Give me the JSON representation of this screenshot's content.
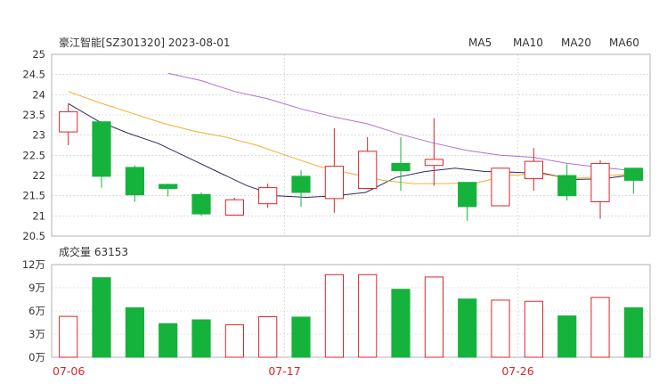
{
  "header": {
    "title": "豪江智能[SZ301320] 2023-08-01",
    "legend": [
      {
        "label": "MA5",
        "color": "#2b2b5e"
      },
      {
        "label": "MA10",
        "color": "#f0b030"
      },
      {
        "label": "MA20",
        "color": "#b070d8"
      },
      {
        "label": "MA60",
        "color": "#e890d8"
      }
    ]
  },
  "volume_panel": {
    "label": "成交量 63153"
  },
  "colors": {
    "up": "#d9262c",
    "down": "#15b33c",
    "grid": "#c8c8c8",
    "frame": "#b0b0b0"
  },
  "chart_data": [
    {
      "type": "candlestick",
      "title": "豪江智能[SZ301320] 2023-08-01",
      "ylim": [
        20.5,
        25
      ],
      "yticks": [
        "25",
        "24.5",
        "24",
        "23.5",
        "23",
        "22.5",
        "22",
        "21.5",
        "21",
        "20.5"
      ],
      "x_date_labels": [
        {
          "index": 0,
          "label": "07-06"
        },
        {
          "index": 7,
          "label": "07-17"
        },
        {
          "index": 14,
          "label": "07-26"
        }
      ],
      "candles": [
        {
          "open": 23.08,
          "close": 23.58,
          "high": 23.78,
          "low": 22.75
        },
        {
          "open": 23.33,
          "close": 21.98,
          "high": 23.33,
          "low": 21.7
        },
        {
          "open": 22.2,
          "close": 21.52,
          "high": 22.25,
          "low": 21.35
        },
        {
          "open": 21.78,
          "close": 21.68,
          "high": 21.8,
          "low": 21.48
        },
        {
          "open": 21.53,
          "close": 21.05,
          "high": 21.58,
          "low": 21.0
        },
        {
          "open": 21.02,
          "close": 21.4,
          "high": 21.45,
          "low": 21.02
        },
        {
          "open": 21.3,
          "close": 21.7,
          "high": 21.8,
          "low": 21.2
        },
        {
          "open": 21.98,
          "close": 21.58,
          "high": 22.13,
          "low": 21.22
        },
        {
          "open": 21.43,
          "close": 22.23,
          "high": 23.17,
          "low": 21.08
        },
        {
          "open": 21.68,
          "close": 22.6,
          "high": 22.95,
          "low": 21.68
        },
        {
          "open": 22.3,
          "close": 22.12,
          "high": 22.95,
          "low": 21.62
        },
        {
          "open": 22.25,
          "close": 22.4,
          "high": 23.42,
          "low": 21.75
        },
        {
          "open": 21.83,
          "close": 21.23,
          "high": 21.83,
          "low": 20.88
        },
        {
          "open": 21.25,
          "close": 22.18,
          "high": 22.18,
          "low": 21.25
        },
        {
          "open": 21.92,
          "close": 22.35,
          "high": 22.68,
          "low": 21.62
        },
        {
          "open": 22.0,
          "close": 21.5,
          "high": 22.28,
          "low": 21.38
        },
        {
          "open": 21.35,
          "close": 22.3,
          "high": 22.38,
          "low": 20.93
        },
        {
          "open": 22.18,
          "close": 21.88,
          "high": 22.18,
          "low": 21.55
        }
      ],
      "ma": [
        {
          "name": "MA5",
          "start": 0,
          "values": [
            23.78,
            23.35,
            23.05,
            22.8,
            22.45,
            22.1,
            21.75,
            21.5,
            21.46,
            21.5,
            21.58,
            21.95,
            22.1,
            22.18,
            22.1,
            22.08,
            22.05,
            21.9,
            21.92,
            22.02
          ]
        },
        {
          "name": "MA10",
          "start": 0,
          "values": [
            24.08,
            23.8,
            23.55,
            23.3,
            23.1,
            22.95,
            22.75,
            22.48,
            22.22,
            22.05,
            21.88,
            21.8,
            21.8,
            21.82,
            22.0,
            22.05,
            21.92,
            21.98,
            22.05
          ]
        },
        {
          "name": "MA20",
          "start": 3,
          "values": [
            24.53,
            24.35,
            24.08,
            23.9,
            23.65,
            23.45,
            23.28,
            23.02,
            22.8,
            22.62,
            22.5,
            22.45,
            22.3,
            22.2,
            22.12
          ]
        }
      ]
    },
    {
      "type": "bar",
      "ylabel": "成交量",
      "ylim": [
        0,
        120000
      ],
      "yticks": [
        "12万",
        "9万",
        "6万",
        "3万",
        "0万"
      ],
      "values": [
        53000,
        103000,
        64000,
        43500,
        48500,
        42000,
        52500,
        52000,
        107000,
        107000,
        88000,
        104000,
        75500,
        74000,
        72500,
        53500,
        77500,
        64000
      ],
      "direction": [
        "up",
        "down",
        "down",
        "down",
        "down",
        "up",
        "up",
        "down",
        "up",
        "up",
        "down",
        "up",
        "down",
        "up",
        "up",
        "down",
        "up",
        "down"
      ]
    }
  ]
}
